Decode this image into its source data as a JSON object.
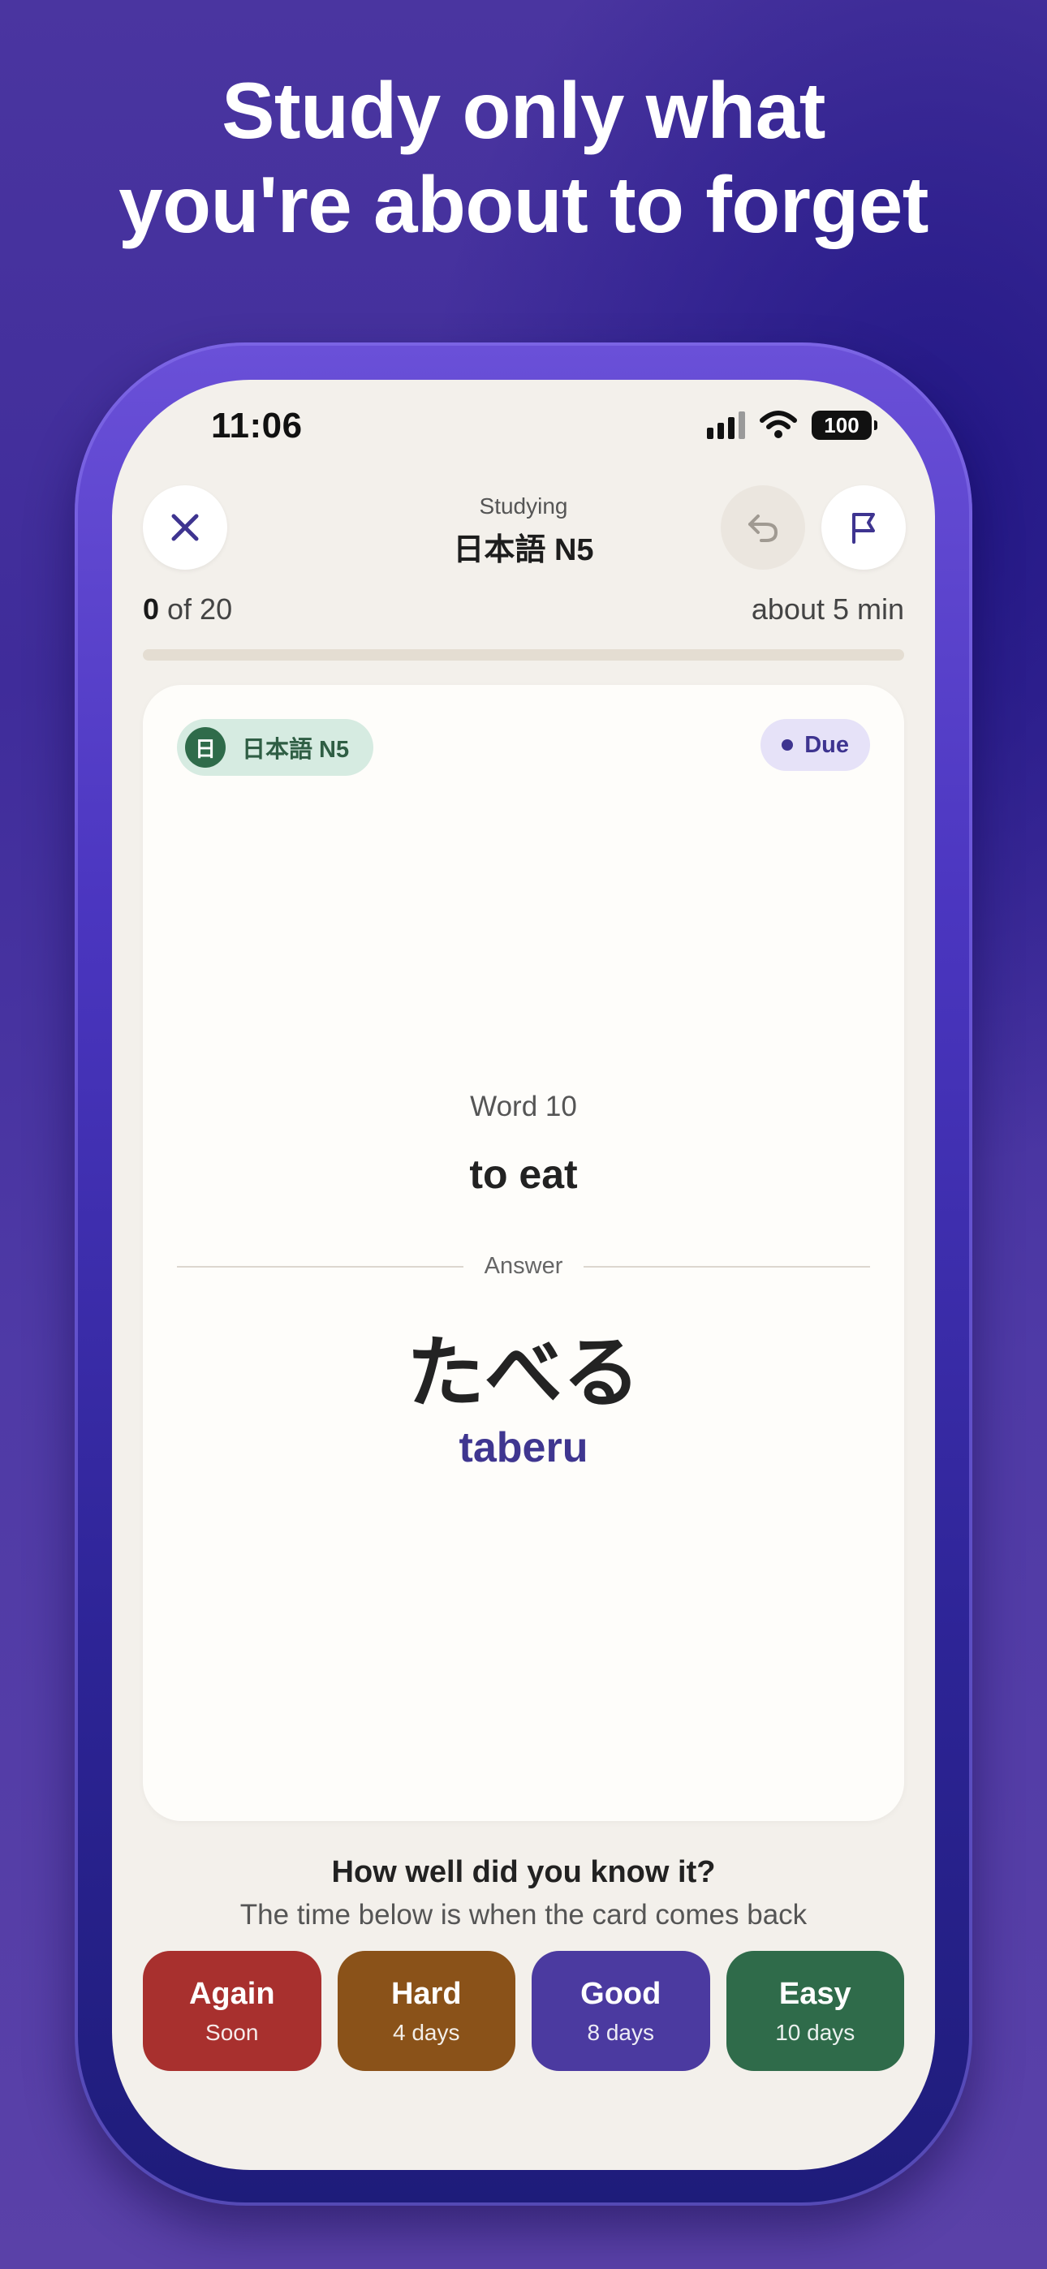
{
  "headline": {
    "line1": "Study only what",
    "line2": "you're about to forget"
  },
  "status_bar": {
    "time": "11:06",
    "battery": "100"
  },
  "header": {
    "subtitle": "Studying",
    "title": "日本語 N5"
  },
  "progress": {
    "done": "0",
    "of_total": " of 20",
    "estimate": "about 5 min",
    "fraction": 0.0
  },
  "card": {
    "deck_badge": "日",
    "deck_name": "日本語 N5",
    "status": "Due",
    "prompt_label": "Word 10",
    "prompt": "to eat",
    "divider_label": "Answer",
    "answer": "たべる",
    "reading": "taberu"
  },
  "rating": {
    "question": "How well did you know it?",
    "hint": "The time below is when the card comes back",
    "buttons": [
      {
        "label": "Again",
        "interval": "Soon",
        "color": "#a8302e"
      },
      {
        "label": "Hard",
        "interval": "4 days",
        "color": "#8a5219"
      },
      {
        "label": "Good",
        "interval": "8 days",
        "color": "#4b3aa0"
      },
      {
        "label": "Easy",
        "interval": "10 days",
        "color": "#2f6b4a"
      }
    ]
  },
  "icons": {
    "close": "close-icon",
    "undo": "undo-icon",
    "flag": "flag-icon",
    "wifi": "wifi-icon",
    "signal": "signal-icon",
    "battery": "battery-icon"
  }
}
